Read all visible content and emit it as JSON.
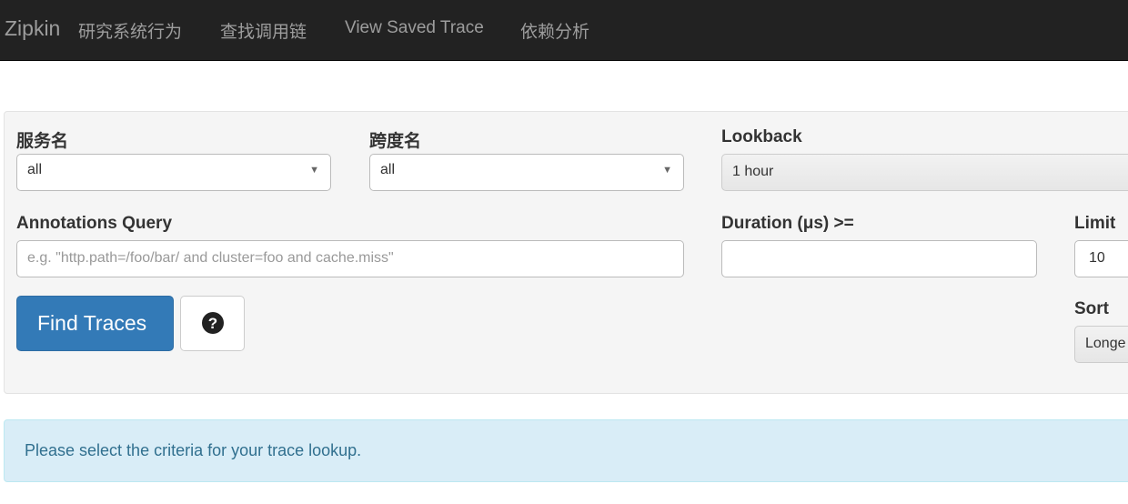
{
  "nav": {
    "brand": "Zipkin",
    "items": [
      "研究系统行为",
      "查找调用链",
      "View Saved Trace",
      "依赖分析"
    ]
  },
  "form": {
    "service_label": "服务名",
    "service_value": "all",
    "span_label": "跨度名",
    "span_value": "all",
    "lookback_label": "Lookback",
    "lookback_value": "1 hour",
    "annotations_label": "Annotations Query",
    "annotations_placeholder": "e.g. \"http.path=/foo/bar/ and cluster=foo and cache.miss\"",
    "duration_label": "Duration (μs) >=",
    "duration_value": "",
    "limit_label": "Limit",
    "limit_value": "10",
    "sort_label": "Sort",
    "sort_value": "Longe",
    "find_button": "Find Traces",
    "help_icon": "question-circle-icon"
  },
  "alert": {
    "message": "Please select the criteria for your trace lookup."
  }
}
